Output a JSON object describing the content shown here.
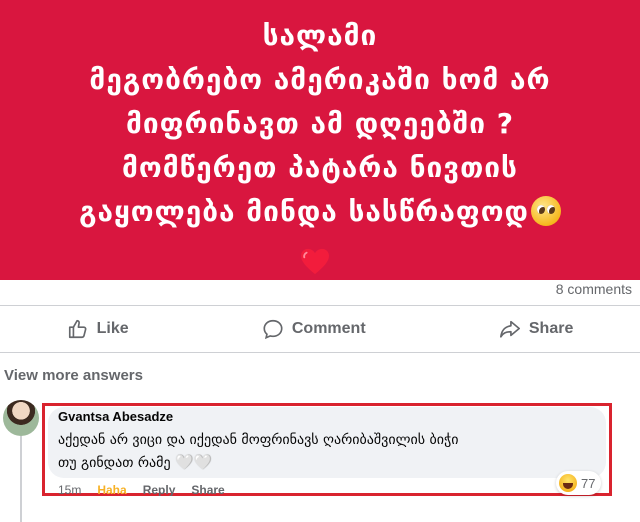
{
  "post": {
    "lines": [
      "სალამი",
      "მეგობრებო ამერიკაში ხომ არ",
      "მიფრინავთ ამ დღეებში ?",
      "მომწერეთ პატარა ნივთის",
      "გაყოლება მინდა სასწრაფოდ"
    ],
    "emojis": [
      "pleading-face",
      "red-heart"
    ],
    "background_color": "#d9163f"
  },
  "comments_count": "8 comments",
  "actions": {
    "like": "Like",
    "comment": "Comment",
    "share": "Share"
  },
  "view_more": "View more answers",
  "comment": {
    "author": "Gvantsa Abesadze",
    "text_line1": "აქედან არ ვიცი და იქედან მოფრინავს ღარიბაშვილის ბიჭი",
    "text_line2": "თუ გინდათ რამე",
    "hearts": "🤍🤍",
    "reaction_icon": "haha-emoji",
    "reaction_count": "77",
    "time": "15m",
    "haha_label": "Haha",
    "reply_label": "Reply",
    "share_label": "Share"
  }
}
